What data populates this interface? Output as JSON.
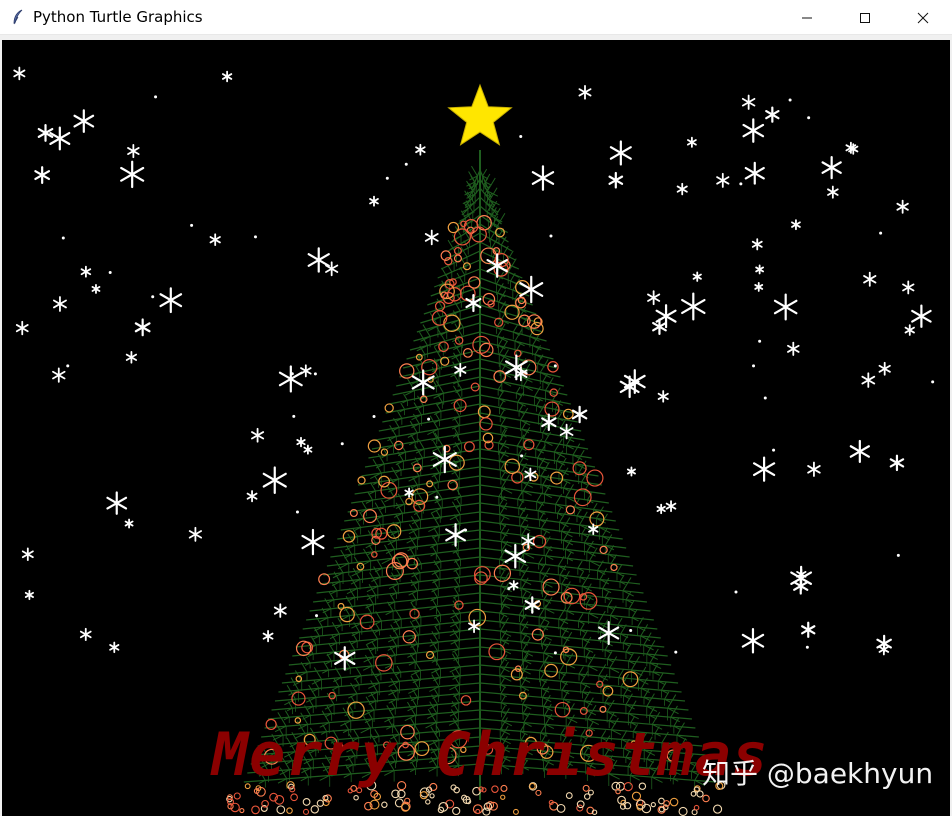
{
  "window": {
    "title": "Python Turtle Graphics",
    "icon": "feather-icon",
    "controls": [
      "minimize-icon",
      "maximize-icon",
      "close-icon"
    ]
  },
  "canvas": {
    "background": "#000000",
    "greeting": "Merry Christmas",
    "greeting_color": "#8b0000",
    "watermark": "知乎 @baekhyun",
    "tree_color": "#1f5e1f",
    "star_color": "#ffe600",
    "snow_color": "#ffffff",
    "ornament_colors": [
      "#e8553a",
      "#ff7f50",
      "#f0a040"
    ]
  }
}
